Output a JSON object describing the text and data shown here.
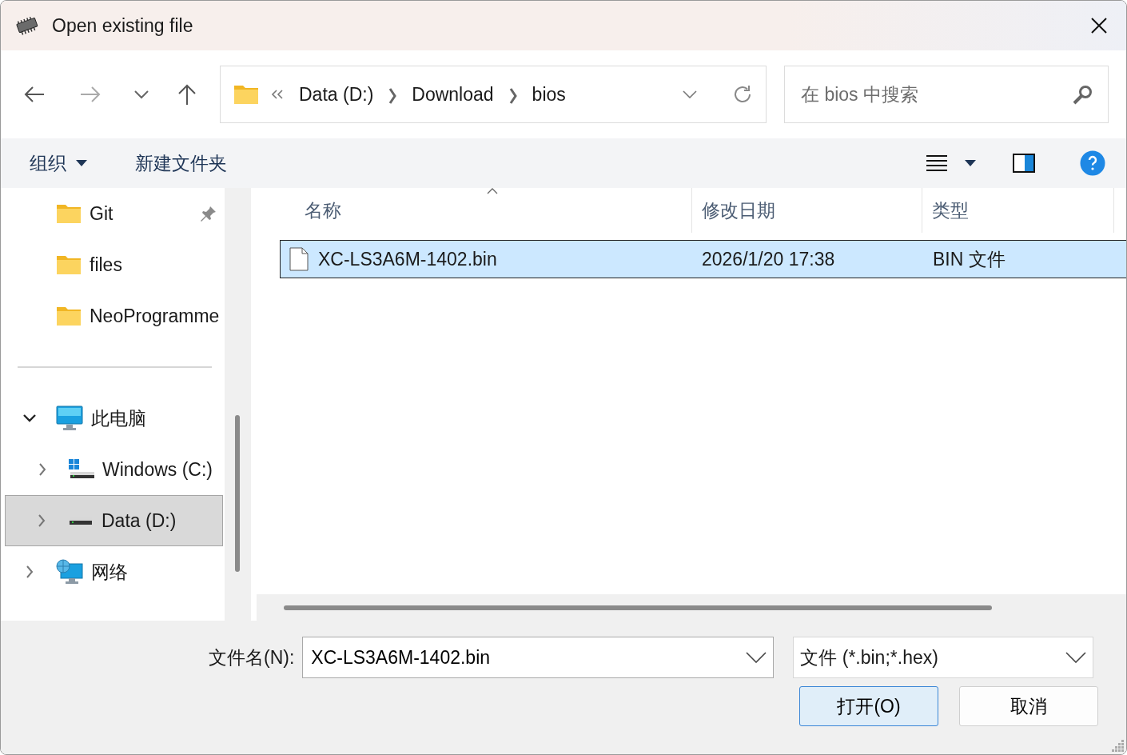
{
  "window": {
    "title": "Open existing file"
  },
  "address_bar": {
    "breadcrumb": [
      {
        "label": "Data (D:)"
      },
      {
        "label": "Download"
      },
      {
        "label": "bios"
      }
    ]
  },
  "search": {
    "placeholder": "在 bios 中搜索"
  },
  "toolbar": {
    "organize": "组织",
    "new_folder": "新建文件夹"
  },
  "sidebar": {
    "quick_access": [
      {
        "label": "Git",
        "pinned": true,
        "selected": false
      },
      {
        "label": "files",
        "pinned": false,
        "selected": false
      },
      {
        "label": "NeoProgramme",
        "pinned": false,
        "selected": false
      }
    ],
    "tree": [
      {
        "label": "此电脑",
        "kind": "pc",
        "expanded": true,
        "selected": false,
        "children": [
          {
            "label": "Windows (C:)",
            "kind": "system-drive",
            "expanded": false,
            "selected": false
          },
          {
            "label": "Data (D:)",
            "kind": "drive",
            "expanded": false,
            "selected": true
          }
        ]
      },
      {
        "label": "网络",
        "kind": "network",
        "expanded": false,
        "selected": false
      }
    ]
  },
  "file_list": {
    "columns": [
      {
        "label": "名称",
        "sorted": true
      },
      {
        "label": "修改日期",
        "sorted": false
      },
      {
        "label": "类型",
        "sorted": false
      }
    ],
    "rows": [
      {
        "name": "XC-LS3A6M-1402.bin",
        "modified": "2026/1/20 17:38",
        "type": "BIN 文件",
        "selected": true
      }
    ]
  },
  "footer": {
    "file_name_label": "文件名(N):",
    "file_name": "XC-LS3A6M-1402.bin",
    "filter": "文件 (*.bin;*.hex)",
    "buttons": [
      {
        "label": "打开(O)",
        "default": true
      },
      {
        "label": "取消",
        "default": false
      }
    ]
  }
}
